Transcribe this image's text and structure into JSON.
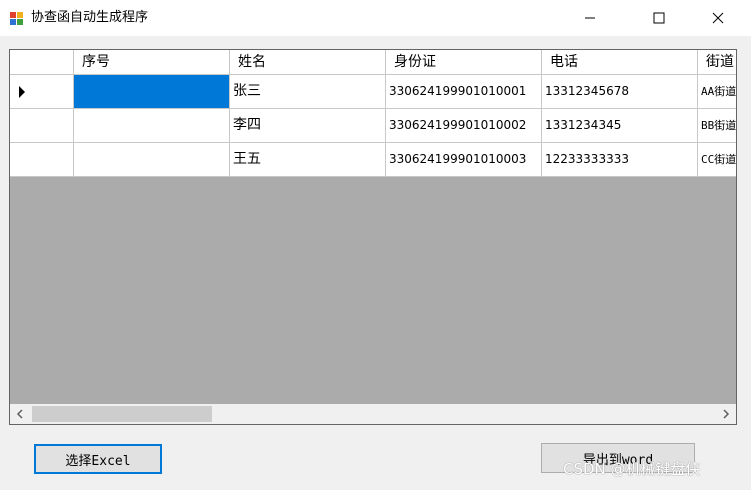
{
  "window": {
    "title": "协查函自动生成程序",
    "minimize_icon": "minimize-icon",
    "maximize_icon": "maximize-icon",
    "close_icon": "close-icon"
  },
  "table": {
    "columns": [
      "序号",
      "姓名",
      "身份证",
      "电话",
      "街道"
    ],
    "rows": [
      {
        "index": "",
        "name": "张三",
        "id": "330624199901010001",
        "phone": "13312345678",
        "street": "AA街道"
      },
      {
        "index": "",
        "name": "李四",
        "id": "330624199901010002",
        "phone": "1331234345",
        "street": "BB街道"
      },
      {
        "index": "",
        "name": "王五",
        "id": "330624199901010003",
        "phone": "12233333333",
        "street": "CC街道"
      }
    ],
    "current_row_icon": "row-pointer-icon"
  },
  "buttons": {
    "select_excel": "选择Excel",
    "export_word": "导出到word"
  },
  "watermark": "CSDN @机械键盘侠",
  "colors": {
    "selection": "#0078d7",
    "grid_background": "#ababab",
    "window_background": "#f0f0f0"
  }
}
